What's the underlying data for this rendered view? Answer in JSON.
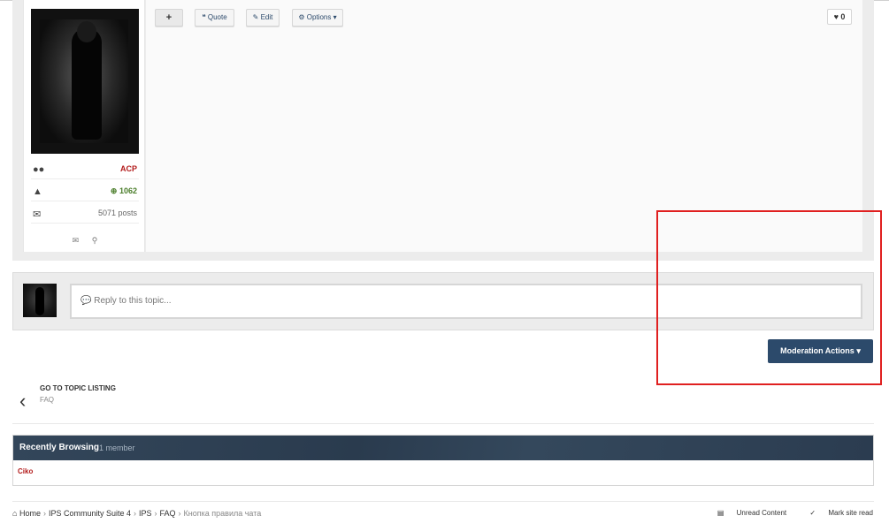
{
  "author": {
    "group": "ACP",
    "reputation": "1062",
    "posts": "5071 posts",
    "icons": [
      "group-icon",
      "thumbs-up-icon",
      "envelope-icon",
      "message-icon",
      "search-icon"
    ]
  },
  "toolbar": {
    "plus_label": "+",
    "quote_label": "Quote",
    "edit_label": "Edit",
    "options_label": "Options",
    "like_count": "0"
  },
  "reply": {
    "placeholder": "Reply to this topic..."
  },
  "moderation": {
    "button_label": "Moderation Actions"
  },
  "goto": {
    "title": "GO TO TOPIC LISTING",
    "subtitle": "FAQ"
  },
  "recently_browsing": {
    "title": "Recently Browsing",
    "count": "1 member",
    "members": [
      "Ciko"
    ]
  },
  "breadcrumb": {
    "items": [
      "Home",
      "IPS Community Suite 4",
      "IPS",
      "FAQ"
    ],
    "current": "Кнопка правила чата"
  },
  "footer": {
    "unread": "Unread Content",
    "mark_read": "Mark site read"
  },
  "colors": {
    "accent": "#2c4a6b",
    "group_color": "#b31b1b",
    "reputation_color": "#4a7d2a",
    "highlight": "#e02020"
  }
}
